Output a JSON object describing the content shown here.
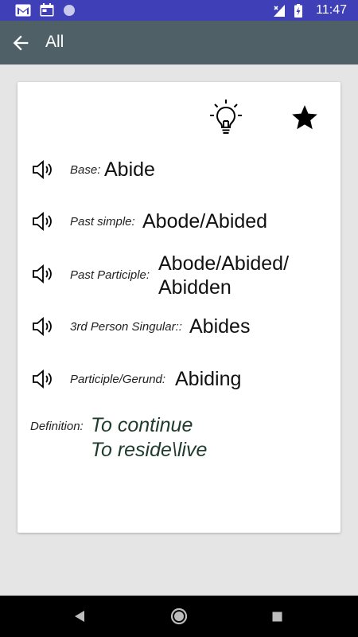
{
  "status_bar": {
    "time": "11:47",
    "icons": [
      "gmail-icon",
      "calendar-icon",
      "circle-notification-icon",
      "no-signal-icon",
      "battery-charging-icon"
    ],
    "background": "#3f3fb8"
  },
  "app_bar": {
    "title": "All",
    "background": "#4f6167"
  },
  "card": {
    "actions": [
      "lightbulb-icon",
      "star-icon"
    ],
    "forms": [
      {
        "label": "Base:",
        "value": "Abide"
      },
      {
        "label": "Past simple:",
        "value": "Abode/Abided"
      },
      {
        "label": "Past Participle:",
        "value_line1": "Abode/Abided/",
        "value_line2": "Abidden"
      },
      {
        "label": "3rd Person Singular::",
        "value": "Abides"
      },
      {
        "label": "Participle/Gerund:",
        "value": "Abiding"
      }
    ],
    "definition": {
      "label": "Definition:",
      "line1": "To continue",
      "line2": "To reside\\live",
      "color": "#1e3b2c"
    }
  },
  "nav_bar": {
    "buttons": [
      "back-triangle-icon",
      "home-circle-icon",
      "recents-square-icon"
    ]
  }
}
